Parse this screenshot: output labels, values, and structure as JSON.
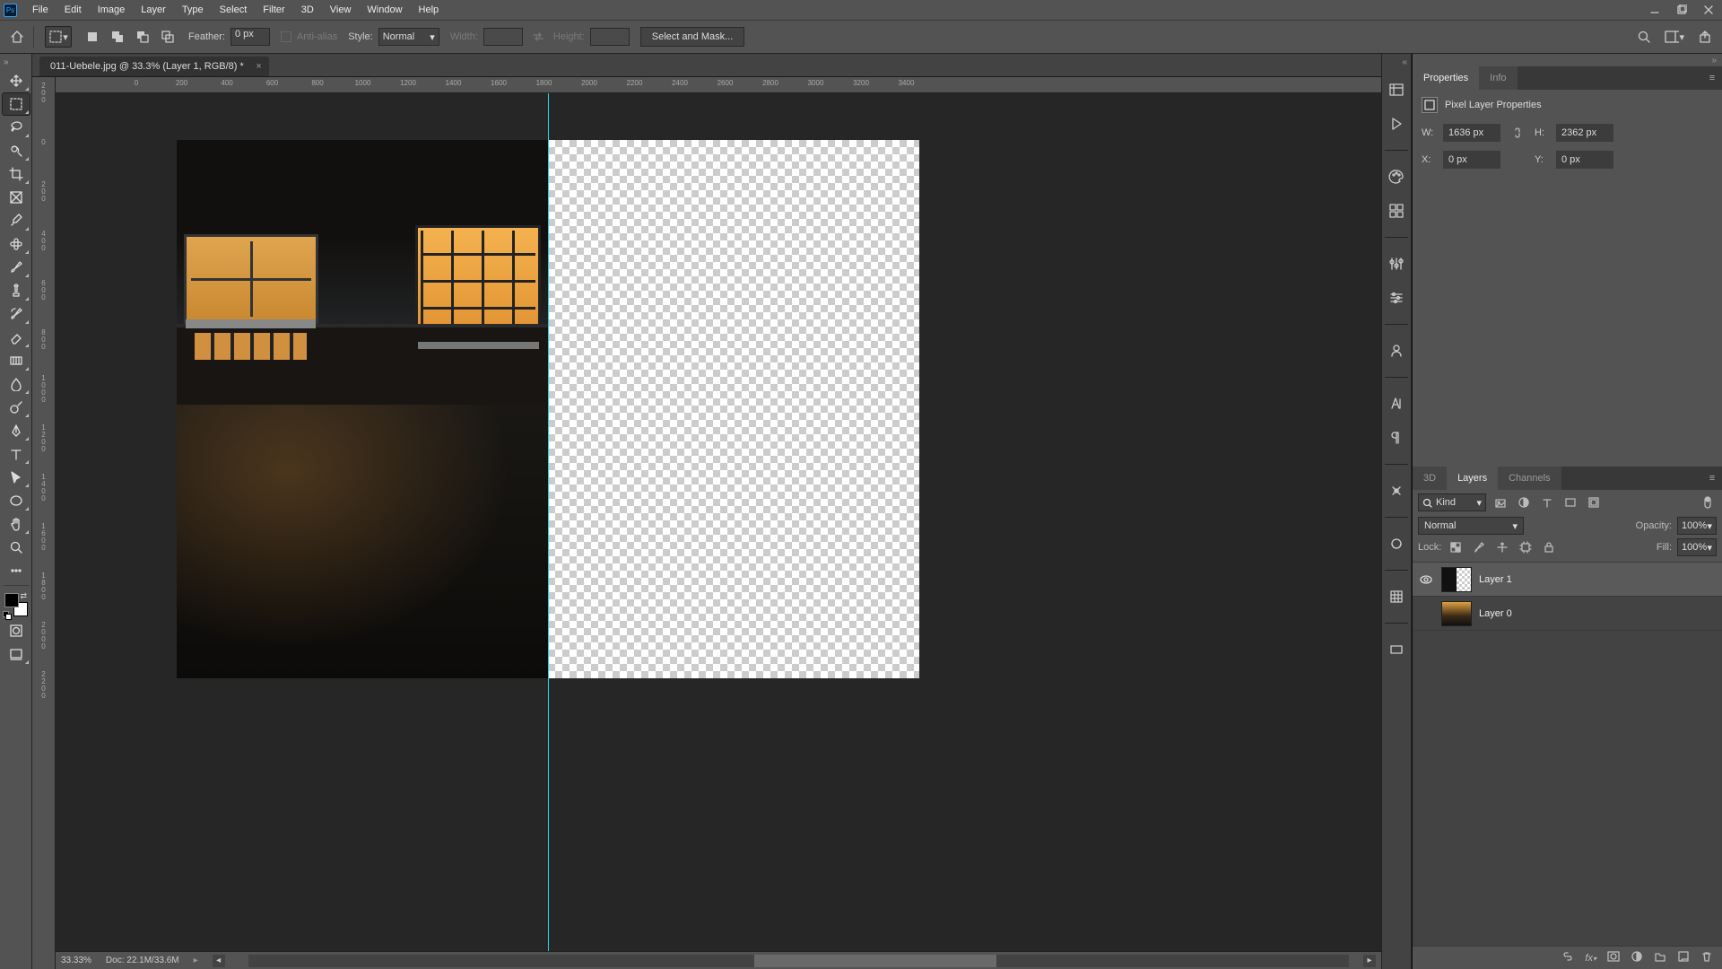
{
  "menu": {
    "items": [
      "File",
      "Edit",
      "Image",
      "Layer",
      "Type",
      "Select",
      "Filter",
      "3D",
      "View",
      "Window",
      "Help"
    ]
  },
  "options": {
    "feather_label": "Feather:",
    "feather_value": "0 px",
    "antialias_label": "Anti-alias",
    "style_label": "Style:",
    "style_value": "Normal",
    "width_label": "Width:",
    "height_label": "Height:",
    "select_mask": "Select and Mask..."
  },
  "document": {
    "tab_title": "011-Uebele.jpg @ 33.3% (Layer 1, RGB/8) *"
  },
  "ruler_h": [
    0,
    200,
    400,
    600,
    800,
    1000,
    1200,
    1400,
    1600,
    1800,
    2000,
    2200,
    2400,
    2600,
    2800,
    3000,
    3200,
    3400
  ],
  "ruler_v": [
    "200",
    "0",
    "200",
    "400",
    "600",
    "800",
    "1000",
    "1200",
    "1400",
    "1600",
    "1800",
    "2000",
    "2200"
  ],
  "status": {
    "zoom": "33.33%",
    "doc": "Doc: 22.1M/33.6M"
  },
  "properties": {
    "tab_properties": "Properties",
    "tab_info": "Info",
    "title": "Pixel Layer Properties",
    "w_label": "W:",
    "w_value": "1636 px",
    "h_label": "H:",
    "h_value": "2362 px",
    "x_label": "X:",
    "x_value": "0 px",
    "y_label": "Y:",
    "y_value": "0 px"
  },
  "layers_panel": {
    "tab_3d": "3D",
    "tab_layers": "Layers",
    "tab_channels": "Channels",
    "kind_label": "Kind",
    "blend_mode": "Normal",
    "opacity_label": "Opacity:",
    "opacity_value": "100%",
    "lock_label": "Lock:",
    "fill_label": "Fill:",
    "fill_value": "100%",
    "layers": [
      {
        "name": "Layer 1",
        "visible": true,
        "selected": true,
        "full": false
      },
      {
        "name": "Layer 0",
        "visible": false,
        "selected": false,
        "full": true
      }
    ]
  }
}
